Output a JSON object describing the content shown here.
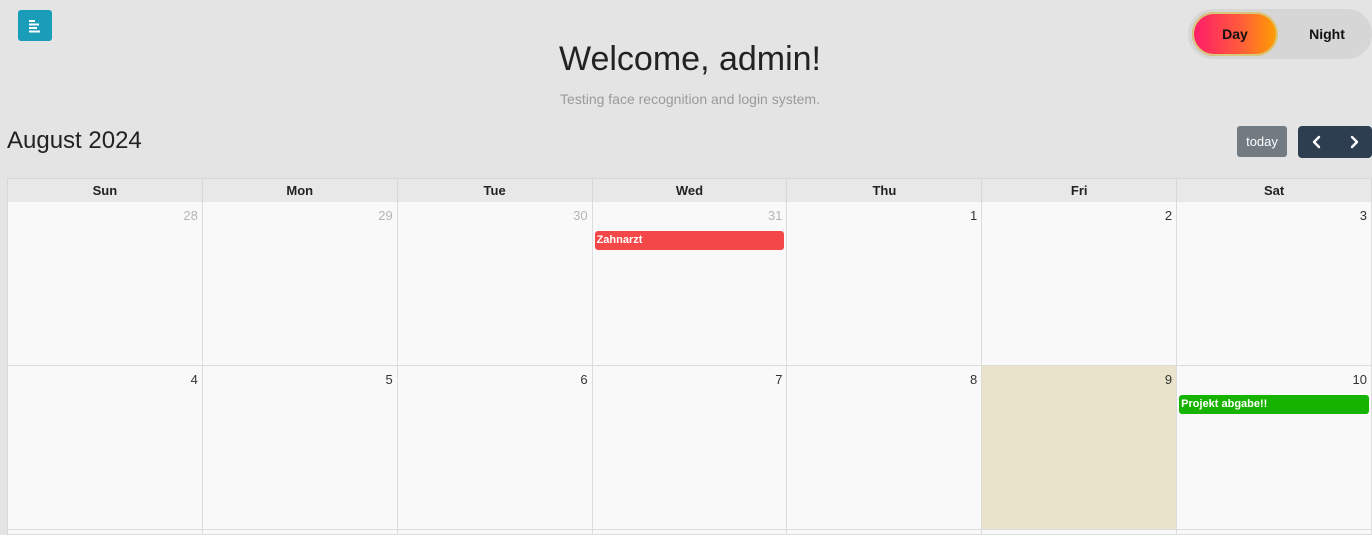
{
  "header": {
    "welcome": "Welcome, admin!",
    "subtitle": "Testing face recognition and login system."
  },
  "menu_button": {
    "icon": "align-left-icon",
    "color": "#1a9db8"
  },
  "theme_toggle": {
    "day_label": "Day",
    "night_label": "Night",
    "selected": "Day"
  },
  "calendar": {
    "title": "August 2024",
    "today_label": "today",
    "prev_icon": "chevron-left-icon",
    "next_icon": "chevron-right-icon",
    "weekdays": [
      "Sun",
      "Mon",
      "Tue",
      "Wed",
      "Thu",
      "Fri",
      "Sat"
    ],
    "weeks": [
      [
        {
          "day": "28",
          "other_month": true
        },
        {
          "day": "29",
          "other_month": true
        },
        {
          "day": "30",
          "other_month": true
        },
        {
          "day": "31",
          "other_month": true,
          "event": {
            "title": "Zahnarzt",
            "color": "#f44747"
          }
        },
        {
          "day": "1"
        },
        {
          "day": "2"
        },
        {
          "day": "3"
        }
      ],
      [
        {
          "day": "4"
        },
        {
          "day": "5"
        },
        {
          "day": "6"
        },
        {
          "day": "7"
        },
        {
          "day": "8"
        },
        {
          "day": "9",
          "today": true
        },
        {
          "day": "10",
          "event": {
            "title": "Projekt abgabe!!",
            "color": "#16b300"
          }
        }
      ]
    ]
  }
}
